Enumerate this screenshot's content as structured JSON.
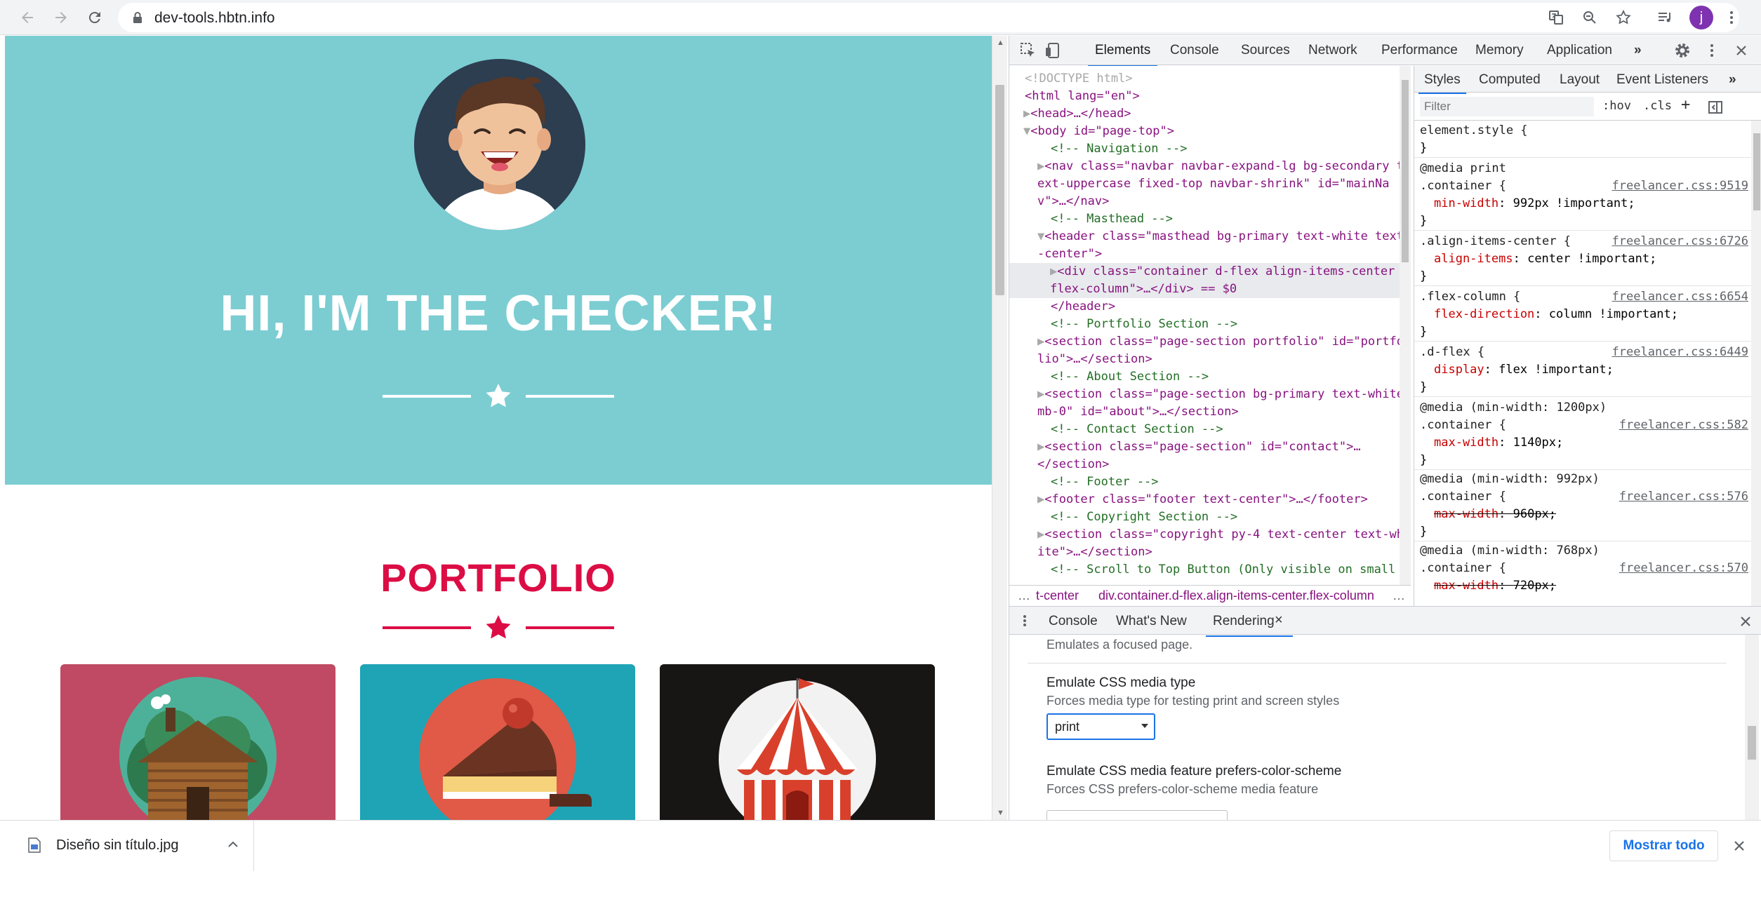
{
  "browser": {
    "url": "dev-tools.hbtn.info",
    "profile_initial": "j"
  },
  "page": {
    "headline": "HI, I'M THE CHECKER!",
    "section_title": "PORTFOLIO",
    "colors": {
      "masthead_bg": "#7bcdd2",
      "accent": "#dc0d45"
    }
  },
  "devtools": {
    "tabs": [
      "Elements",
      "Console",
      "Sources",
      "Network",
      "Performance",
      "Memory",
      "Application"
    ],
    "dom_lines": [
      "<!DOCTYPE html>",
      "<html lang=\"en\">",
      "<head>…</head>",
      "<body id=\"page-top\">",
      "<!-- Navigation -->",
      "<nav class=\"navbar navbar-expand-lg bg-secondary t",
      "ext-uppercase fixed-top navbar-shrink\" id=\"mainNa",
      "v\">…</nav>",
      "<!-- Masthead -->",
      "<header class=\"masthead bg-primary text-white text",
      "-center\">",
      "<div class=\"container d-flex align-items-center",
      "flex-column\">…</div> == $0",
      "</header>",
      "<!-- Portfolio Section -->",
      "<section class=\"page-section portfolio\" id=\"portfo",
      "lio\">…</section>",
      "<!-- About Section -->",
      "<section class=\"page-section bg-primary text-white",
      "mb-0\" id=\"about\">…</section>",
      "<!-- Contact Section -->",
      "<section class=\"page-section\" id=\"contact\">…",
      "</section>",
      "<!-- Footer -->",
      "<footer class=\"footer text-center\">…</footer>",
      "<!-- Copyright Section -->",
      "<section class=\"copyright py-4 text-center text-wh",
      "ite\">…</section>",
      "<!-- Scroll to Top Button (Only visible on small"
    ],
    "breadcrumbs": [
      "…",
      "t-center",
      "div.container.d-flex.align-items-center.flex-column",
      "…"
    ],
    "styles_tabs": [
      "Styles",
      "Computed",
      "Layout",
      "Event Listeners"
    ],
    "filter_placeholder": "Filter",
    "filter_buttons": [
      ":hov",
      ".cls",
      "+"
    ],
    "rules": [
      {
        "header": [
          "element.style {"
        ],
        "props": [],
        "close": "}"
      },
      {
        "header": [
          "@media print",
          ".container {"
        ],
        "source": "freelancer.css:9519",
        "props": [
          {
            "name": "min-width",
            "value": "992px !important;",
            "struck": false
          }
        ],
        "close": "}"
      },
      {
        "header": [
          ".align-items-center {"
        ],
        "source": "freelancer.css:6726",
        "props": [
          {
            "name": "align-items",
            "value": "center !important;",
            "struck": false
          }
        ],
        "close": "}"
      },
      {
        "header": [
          ".flex-column {"
        ],
        "source": "freelancer.css:6654",
        "props": [
          {
            "name": "flex-direction",
            "value": "column !important;",
            "struck": false
          }
        ],
        "close": "}"
      },
      {
        "header": [
          ".d-flex {"
        ],
        "source": "freelancer.css:6449",
        "props": [
          {
            "name": "display",
            "value": "flex !important;",
            "struck": false
          }
        ],
        "close": "}"
      },
      {
        "header": [
          "@media (min-width: 1200px)",
          ".container {"
        ],
        "source": "freelancer.css:582",
        "props": [
          {
            "name": "max-width",
            "value": "1140px;",
            "struck": false
          }
        ],
        "close": "}"
      },
      {
        "header": [
          "@media (min-width: 992px)",
          ".container {"
        ],
        "source": "freelancer.css:576",
        "props": [
          {
            "name": "max-width",
            "value": "960px;",
            "struck": true
          }
        ],
        "close": "}"
      },
      {
        "header": [
          "@media (min-width: 768px)",
          ".container {"
        ],
        "source": "freelancer.css:570",
        "props": [
          {
            "name": "max-width",
            "value": "720px;",
            "struck": true
          }
        ],
        "close": ""
      }
    ],
    "drawer": {
      "tabs": [
        "Console",
        "What's New",
        "Rendering"
      ],
      "focused_desc": "Emulates a focused page.",
      "media_type_title": "Emulate CSS media type",
      "media_type_desc": "Forces media type for testing print and screen styles",
      "media_type_value": "print",
      "color_scheme_title": "Emulate CSS media feature prefers-color-scheme",
      "color_scheme_desc": "Forces CSS prefers-color-scheme media feature"
    }
  },
  "downloads": {
    "file_name": "Diseño sin título.jpg",
    "show_all": "Mostrar todo"
  }
}
